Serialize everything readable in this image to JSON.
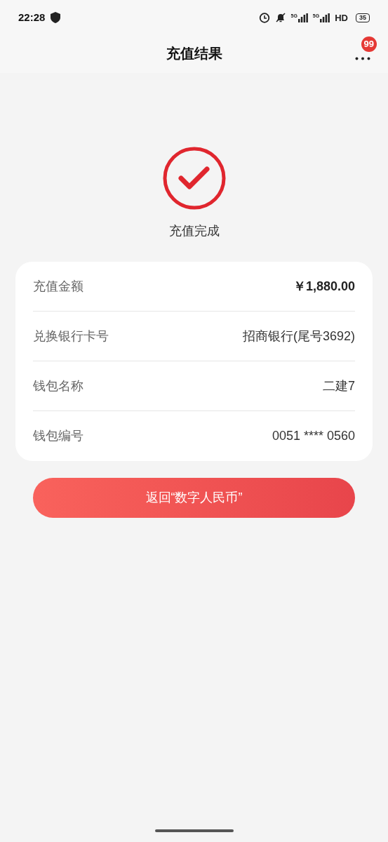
{
  "status_bar": {
    "time": "22:28",
    "network_1": "5G",
    "network_2": "5G",
    "hd": "HD",
    "battery": "35"
  },
  "header": {
    "title": "充值结果",
    "badge": "99"
  },
  "result": {
    "status": "充值完成"
  },
  "details": [
    {
      "label": "充值金额",
      "value": "￥1,880.00",
      "kind": "amount"
    },
    {
      "label": "兑换银行卡号",
      "value": "招商银行(尾号3692)",
      "kind": "text"
    },
    {
      "label": "钱包名称",
      "value": "二建7",
      "kind": "text"
    },
    {
      "label": "钱包编号",
      "value": "0051 **** 0560",
      "kind": "text"
    }
  ],
  "button": "返回“数字人民币”"
}
